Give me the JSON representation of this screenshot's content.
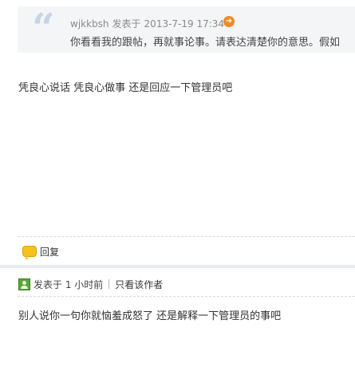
{
  "quote": {
    "author": "wjkkbsh",
    "posted_label": "发表于",
    "timestamp": "2013-7-19 17:34",
    "go_icon": "arrow-circle-icon",
    "text": "你看看我的跟帖，再就事论事。请表达清楚你的意思。假如"
  },
  "post": {
    "text": "凭良心说话 凭良心做事 还是回应一下管理员吧",
    "reply_label": "回复",
    "reply_icon": "speech-bubble-icon"
  },
  "post2": {
    "posted_label": "发表于",
    "time_ago": "1 小时前",
    "only_author_label": "只看该作者",
    "user_icon": "user-avatar-icon",
    "text": "别人说你一句你就恼羞成怒了 还是解释一下管理员的事吧"
  },
  "colors": {
    "quote_bg": "#f4f5f7",
    "quote_mark": "#c6d4e6",
    "accent_orange": "#f08a24",
    "separator": "#e6ecf2"
  }
}
